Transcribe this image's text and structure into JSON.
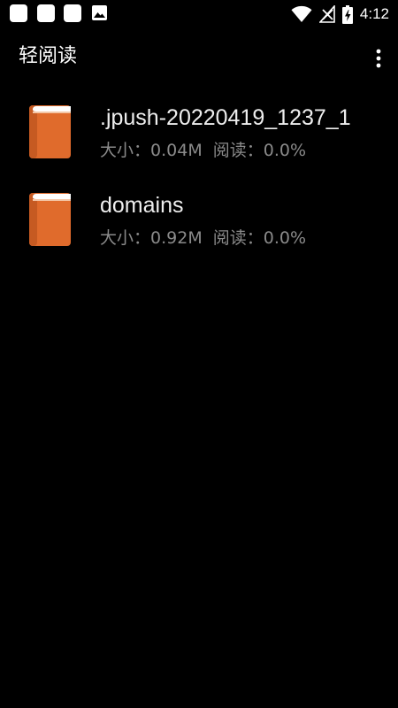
{
  "status_bar": {
    "time": "4:12",
    "icons": [
      "notification-icon",
      "notification-icon",
      "notification-icon",
      "image-icon",
      "wifi-icon",
      "no-signal-icon",
      "battery-charging-icon"
    ]
  },
  "toolbar": {
    "title": "轻阅读",
    "menu_icon": "more-vert-icon"
  },
  "books": [
    {
      "title": ".jpush-20220419_1237_1",
      "size_label": "大小：",
      "size": "0.04M",
      "progress_label": "阅读：",
      "progress": "0.0%"
    },
    {
      "title": "domains",
      "size_label": "大小：",
      "size": "0.92M",
      "progress_label": "阅读：",
      "progress": "0.0%"
    }
  ],
  "colors": {
    "background": "#000000",
    "book_cover": "#E06B2C",
    "meta_text": "#8A8A8A"
  }
}
